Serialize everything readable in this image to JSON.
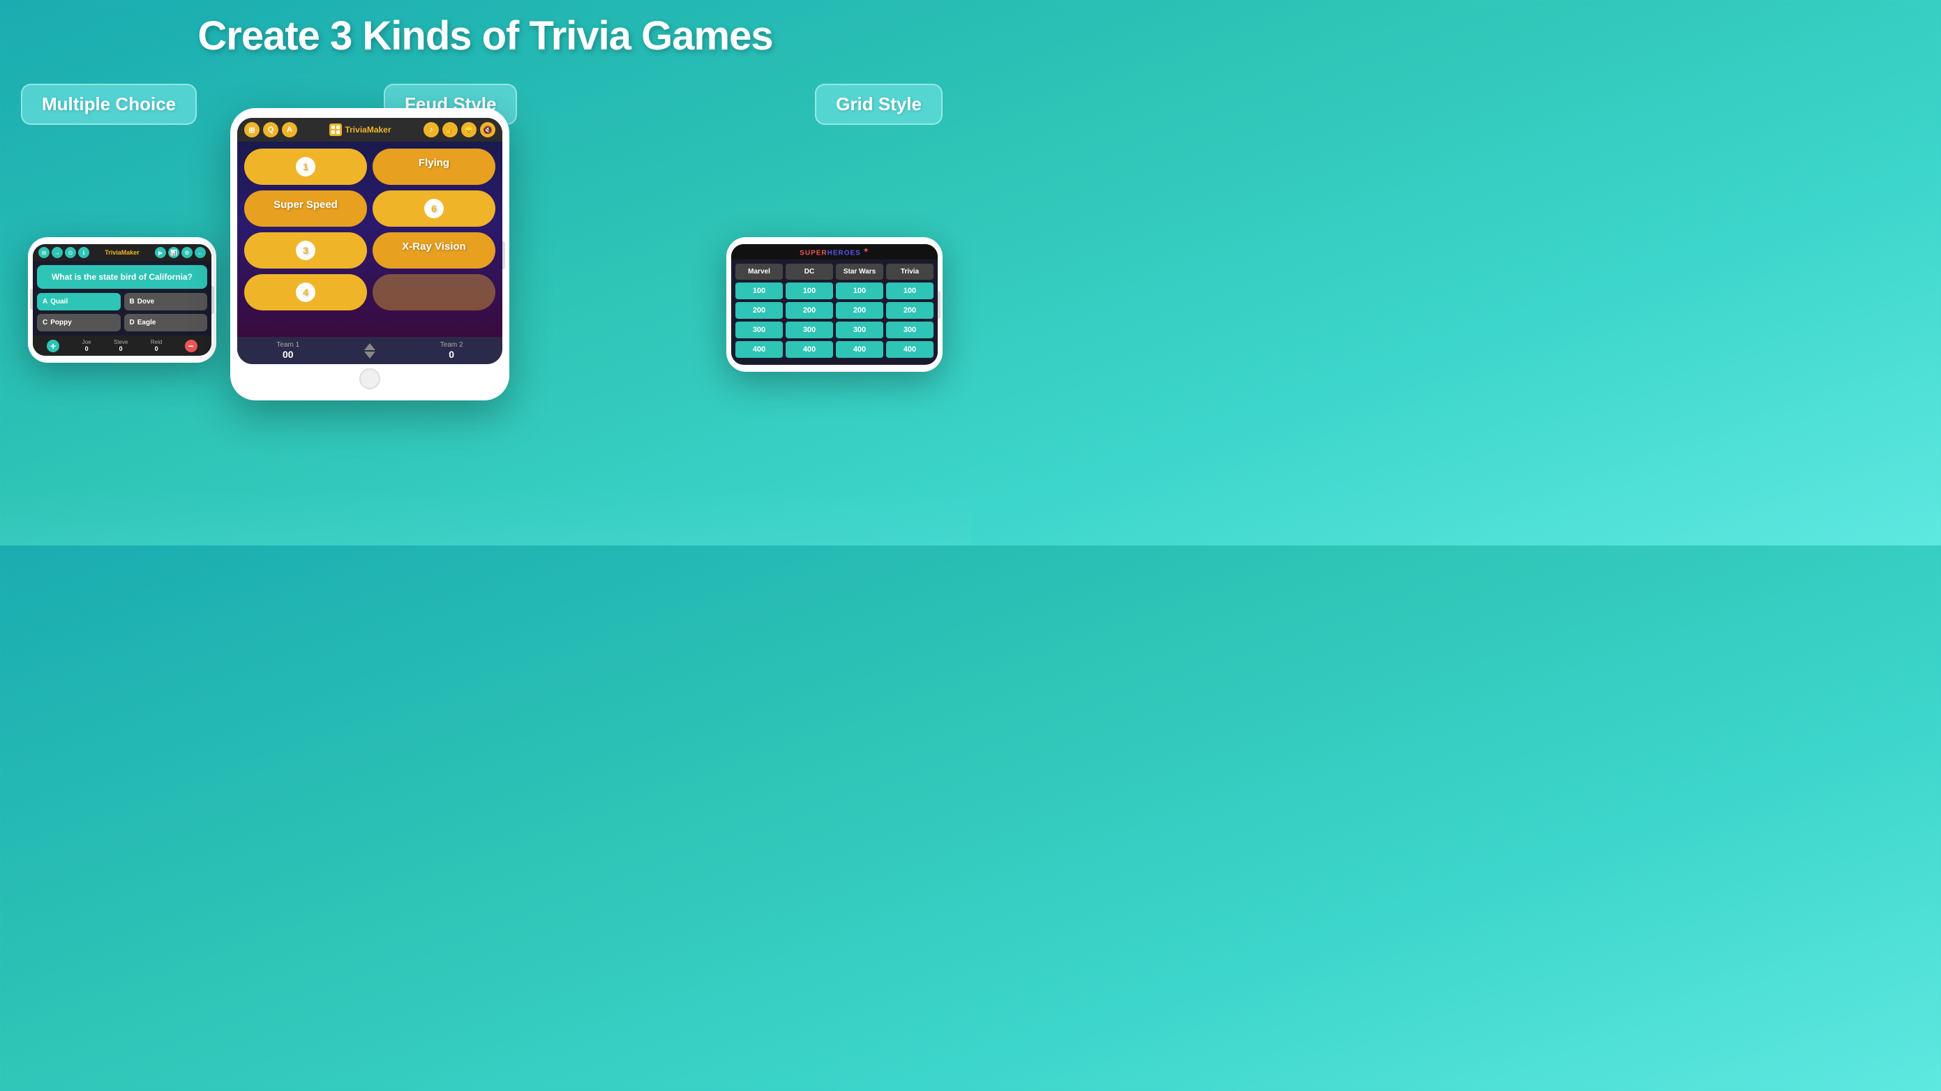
{
  "page": {
    "title": "Create 3 Kinds of Trivia Games",
    "background_color": "#2abfbd"
  },
  "badges": {
    "multiple_choice": "Multiple Choice",
    "feud_style": "Feud Style",
    "grid_style": "Grid Style"
  },
  "tablet": {
    "app_name": "TriviaMaker",
    "feud": {
      "rows": [
        {
          "left": "1",
          "right": "Flying"
        },
        {
          "left": "Super Speed",
          "right": "6"
        },
        {
          "left": "3",
          "right": "X-Ray Vision"
        },
        {
          "left": "4",
          "right": ""
        }
      ],
      "team1_label": "Team 1",
      "team1_score": "00",
      "team2_label": "Team 2",
      "team2_score": "0"
    }
  },
  "phone_left": {
    "app_name": "TriviaMaker",
    "question": "What is the state bird of California?",
    "options": [
      {
        "letter": "A",
        "text": "Quail",
        "correct": true
      },
      {
        "letter": "B",
        "text": "Dove",
        "correct": false
      },
      {
        "letter": "C",
        "text": "Poppy",
        "correct": false
      },
      {
        "letter": "D",
        "text": "Eagle",
        "correct": false
      }
    ],
    "players": [
      {
        "name": "Joe",
        "score": "0"
      },
      {
        "name": "Steve",
        "score": "0"
      },
      {
        "name": "Reid",
        "score": "0"
      }
    ]
  },
  "phone_right": {
    "app_name": "SUPERHEROES",
    "columns": [
      "Marvel",
      "DC",
      "Star Wars",
      "Trivia"
    ],
    "rows": [
      [
        "100",
        "100",
        "100",
        "100"
      ],
      [
        "200",
        "200",
        "200",
        "200"
      ],
      [
        "300",
        "300",
        "300",
        "300"
      ],
      [
        "400",
        "400",
        "400",
        "400"
      ]
    ]
  }
}
